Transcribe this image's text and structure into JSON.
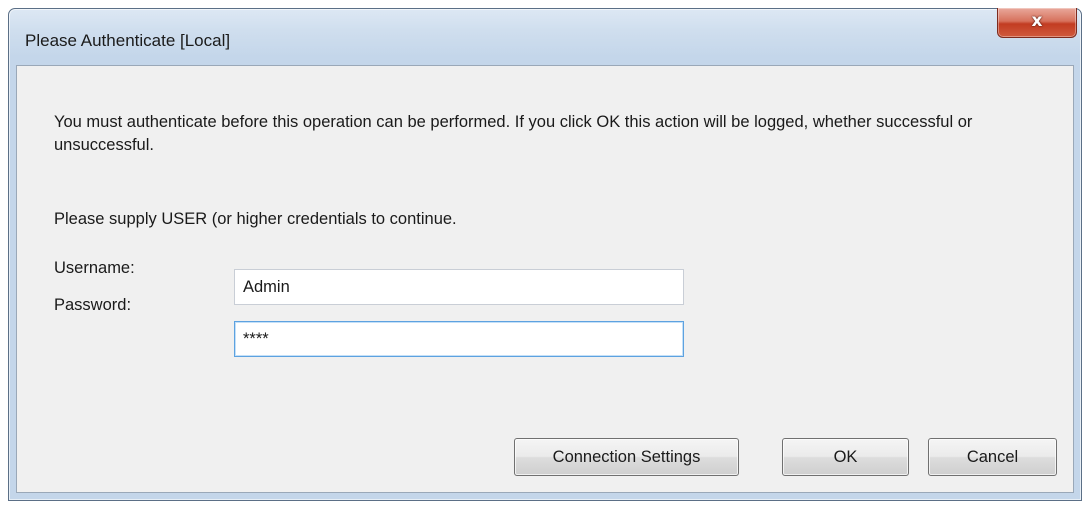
{
  "window": {
    "title": "Please Authenticate [Local]",
    "close_glyph": "x"
  },
  "body": {
    "message": "You must authenticate before this operation can be performed. If you click OK this action will be logged, whether successful or unsuccessful.",
    "supply_text": "Please supply USER (or higher credentials to continue."
  },
  "form": {
    "username_label": "Username:",
    "username_value": "Admin",
    "password_label": "Password:",
    "password_value": "****"
  },
  "buttons": {
    "connection_settings": "Connection Settings",
    "ok": "OK",
    "cancel": "Cancel"
  },
  "colors": {
    "close_button": "#c94a30",
    "focus_border": "#5da2e0",
    "dialog_face": "#f0f0f0",
    "frame": "#c4d6ea"
  }
}
